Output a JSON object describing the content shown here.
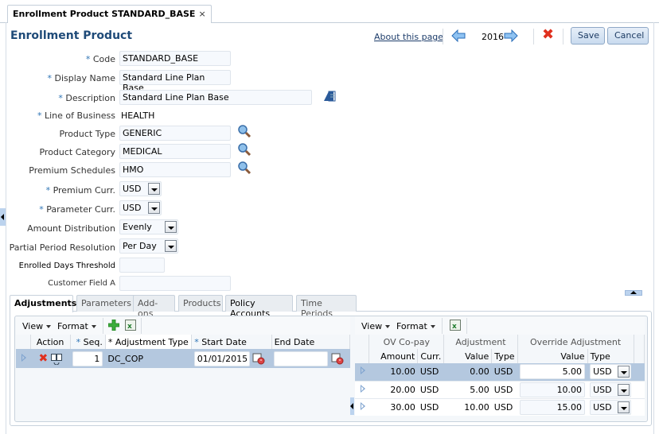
{
  "document_tab": {
    "title": "Enrollment Product STANDARD_BASE",
    "close_glyph": "×"
  },
  "header": {
    "page_title": "Enrollment Product",
    "about_link": "About this page",
    "year": "2016",
    "save_label": "Save",
    "cancel_label": "Cancel",
    "delete_glyph": "✖"
  },
  "form": {
    "required_mark": "*",
    "code": {
      "label": "Code",
      "value": "STANDARD_BASE"
    },
    "display_name": {
      "label": "Display Name",
      "value": "Standard Line Plan Base"
    },
    "description": {
      "label": "Description",
      "value": "Standard Line Plan Base"
    },
    "line_of_business": {
      "label": "Line of Business",
      "value": "HEALTH"
    },
    "product_type": {
      "label": "Product Type",
      "value": "GENERIC"
    },
    "product_category": {
      "label": "Product Category",
      "value": "MEDICAL"
    },
    "premium_schedules": {
      "label": "Premium Schedules",
      "value": "HMO"
    },
    "premium_curr": {
      "label": "Premium Curr.",
      "value": "USD"
    },
    "parameter_curr": {
      "label": "Parameter Curr.",
      "value": "USD"
    },
    "amount_distribution": {
      "label": "Amount Distribution",
      "value": "Evenly"
    },
    "partial_period_resolution": {
      "label": "Partial Period Resolution",
      "value": "Per Day"
    },
    "enrolled_days_threshold": {
      "label": "Enrolled Days Threshold",
      "value": ""
    },
    "customer_field_a": {
      "label": "Customer Field A",
      "value": ""
    }
  },
  "tabs": [
    {
      "label": "Adjustments",
      "active": true
    },
    {
      "label": "Parameters"
    },
    {
      "label": "Add-ons"
    },
    {
      "label": "Products"
    },
    {
      "label": "Policy Accounts"
    },
    {
      "label": "Time Periods"
    }
  ],
  "left_table": {
    "toolbar": {
      "view": "View",
      "format": "Format"
    },
    "columns": [
      "Action",
      "Seq.",
      "Adjustment Type",
      "Start Date",
      "End Date"
    ],
    "rows": [
      {
        "seq": "1",
        "adjustment_type": "DC_COP",
        "start_date": "01/01/2015",
        "end_date": ""
      }
    ]
  },
  "right_table": {
    "toolbar": {
      "view": "View",
      "format": "Format"
    },
    "groups": [
      "OV Co-pay",
      "Adjustment",
      "Override Adjustment"
    ],
    "columns": [
      "Amount",
      "Curr.",
      "Value",
      "Type",
      "Value",
      "Type"
    ],
    "rows": [
      {
        "amount": "10.00",
        "curr": "USD",
        "adj_value": "0.00",
        "adj_type": "USD",
        "ovr_value": "5.00",
        "ovr_type": "USD"
      },
      {
        "amount": "20.00",
        "curr": "USD",
        "adj_value": "5.00",
        "adj_type": "USD",
        "ovr_value": "10.00",
        "ovr_type": "USD"
      },
      {
        "amount": "30.00",
        "curr": "USD",
        "adj_value": "10.00",
        "adj_type": "USD",
        "ovr_value": "15.00",
        "ovr_type": "USD"
      }
    ]
  }
}
